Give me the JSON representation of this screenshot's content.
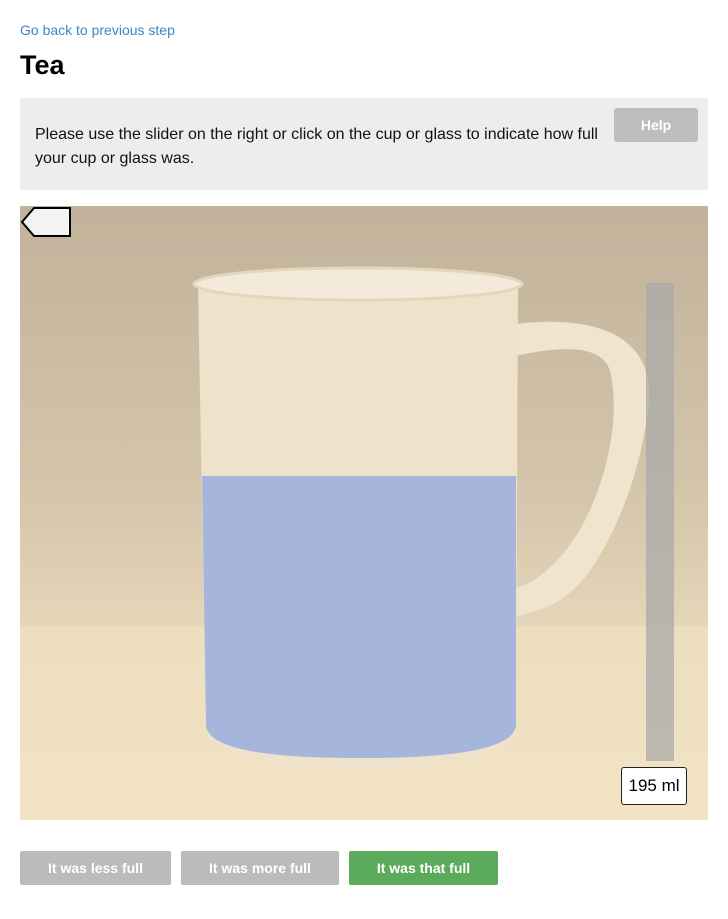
{
  "nav": {
    "back_label": "Go back to previous step"
  },
  "page": {
    "title": "Tea"
  },
  "instructions": {
    "text": "Please use the slider on the right or click on the cup or glass to indicate how full your cup or glass was.",
    "help_label": "Help"
  },
  "portion": {
    "volume_label": "195 ml",
    "fill_level_fraction": 0.57
  },
  "actions": {
    "less_label": "It was less full",
    "more_label": "It was more full",
    "that_label": "It was that full"
  },
  "colors": {
    "link": "#3a87c8",
    "primary_action": "#5cab5a",
    "secondary_action": "#bbbbbb",
    "fill_overlay": "#9fb1dc"
  }
}
